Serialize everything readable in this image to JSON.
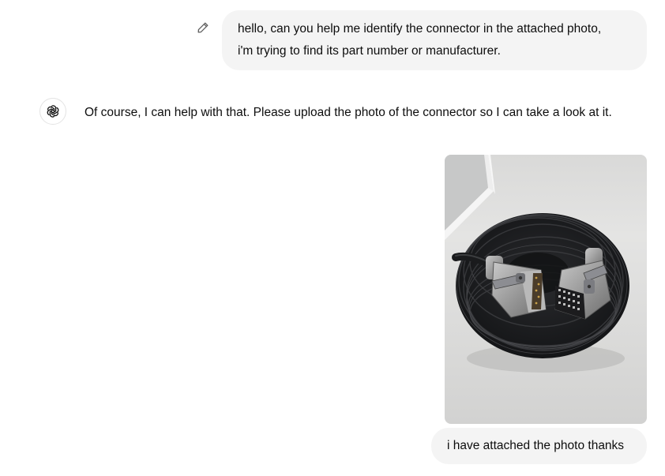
{
  "conversation": {
    "user_message_1": {
      "lines": [
        "hello, can you help me identify the connector in the attached photo,",
        "i'm trying to find its part number or manufacturer."
      ]
    },
    "assistant_message_1": {
      "text": "Of course, I can help with that. Please upload the photo of the connector so I can take a look at it."
    },
    "user_message_2": {
      "image": {
        "icon": "connector-cable-photo"
      },
      "text": "i have attached the photo thanks"
    }
  },
  "icons": {
    "edit": "pencil-icon",
    "assistant_avatar": "openai-logo-icon"
  },
  "colors": {
    "user_bubble_bg": "#f4f4f4",
    "text": "#0d0d0d",
    "background": "#ffffff"
  }
}
